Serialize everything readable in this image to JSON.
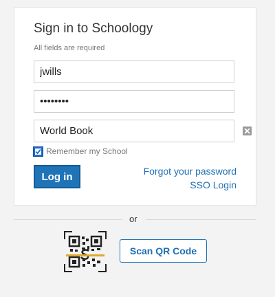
{
  "form": {
    "title": "Sign in to Schoology",
    "required_note": "All fields are required",
    "username_value": "jwills",
    "password_value": "••••••••",
    "school_value": "World Book",
    "remember_label": "Remember my School",
    "remember_checked": true,
    "login_label": "Log in",
    "forgot_label": "Forgot your password",
    "sso_label": "SSO Login"
  },
  "alt": {
    "or_label": "or",
    "qr_icon": "qr-code-icon",
    "scan_label": "Scan QR Code"
  },
  "colors": {
    "accent": "#1f74b8",
    "link": "#1f6fb5",
    "background": "#f3f3f3"
  }
}
